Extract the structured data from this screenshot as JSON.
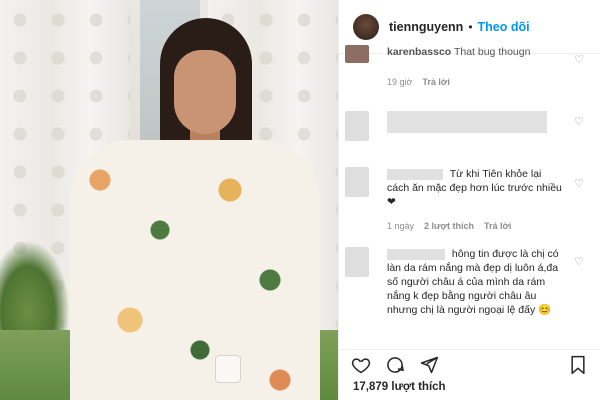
{
  "post": {
    "username": "tiennguyenn",
    "follow_label": "Theo dõi",
    "separator": "•"
  },
  "comments": [
    {
      "author": "karenbassco",
      "text": "That bug thougn",
      "time": "19 giờ",
      "reply": "Trả lời"
    },
    {
      "author": "",
      "text": "",
      "time": "",
      "reply": ""
    },
    {
      "author": "",
      "text": "Từ khi Tiên khỏe lại cách ăn mặc đẹp hơn lúc trước nhiều ❤",
      "time": "1 ngày",
      "likes": "2 lượt thích",
      "reply": "Trả lời"
    },
    {
      "author": "",
      "text": "hông tin được là chị có làn da rám nắng mà đẹp dị luôn á,đa số người châu á của mình da rám nắng k đẹp bằng người châu âu nhưng chị là người ngoại lệ đấy 😊",
      "time": "",
      "reply": ""
    }
  ],
  "footer": {
    "likes": "17,879 lượt thích"
  },
  "icons": {
    "heart": "heart-icon",
    "comment": "comment-icon",
    "share": "share-icon",
    "bookmark": "bookmark-icon"
  },
  "colors": {
    "follow": "#0095f6",
    "meta": "#8e8e8e"
  }
}
